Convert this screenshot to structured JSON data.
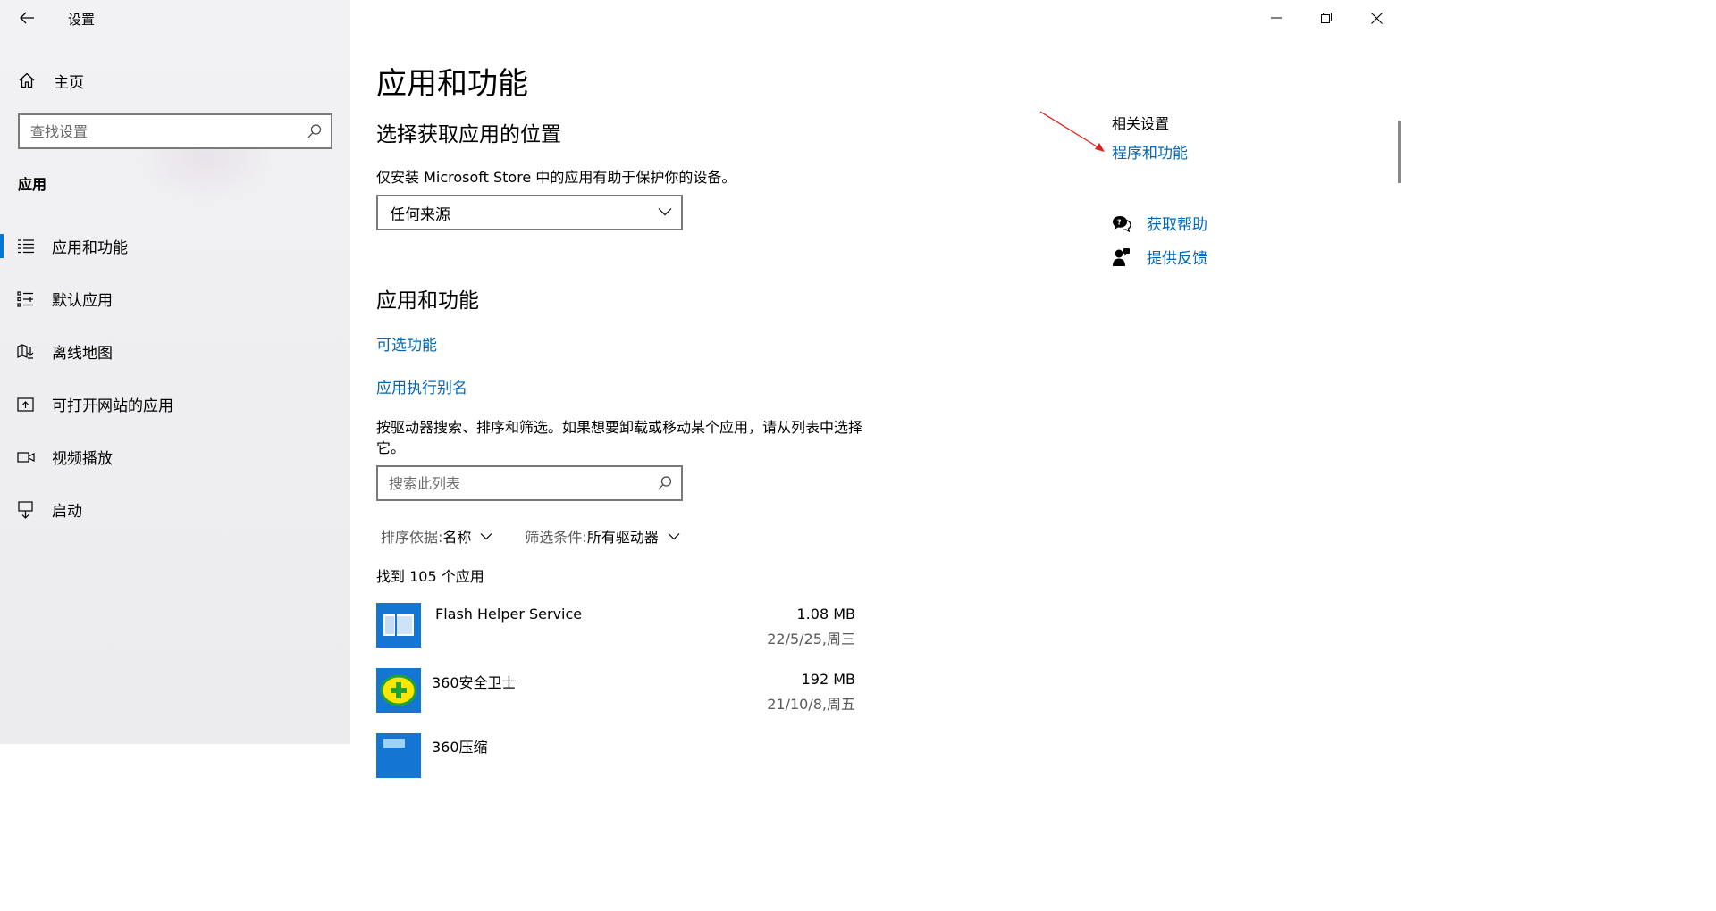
{
  "window": {
    "title": "设置"
  },
  "sidebar": {
    "home_label": "主页",
    "search_placeholder": "查找设置",
    "section_label": "应用",
    "items": [
      {
        "label": "应用和功能",
        "icon": "apps-list-icon",
        "active": true
      },
      {
        "label": "默认应用",
        "icon": "default-apps-icon",
        "active": false
      },
      {
        "label": "离线地图",
        "icon": "map-download-icon",
        "active": false
      },
      {
        "label": "可打开网站的应用",
        "icon": "open-web-icon",
        "active": false
      },
      {
        "label": "视频播放",
        "icon": "video-icon",
        "active": false
      },
      {
        "label": "启动",
        "icon": "startup-icon",
        "active": false
      }
    ]
  },
  "main": {
    "page_title": "应用和功能",
    "source_heading": "选择获取应用的位置",
    "source_desc": "仅安装 Microsoft Store 中的应用有助于保护你的设备。",
    "source_value": "任何来源",
    "apps_heading": "应用和功能",
    "optional_features_link": "可选功能",
    "alias_link": "应用执行别名",
    "list_desc": "按驱动器搜索、排序和筛选。如果想要卸载或移动某个应用，请从列表中选择它。",
    "list_search_placeholder": "搜索此列表",
    "sort_key": "排序依据: ",
    "sort_value": "名称",
    "filter_key": "筛选条件: ",
    "filter_value": "所有驱动器",
    "found_count": "找到 105 个应用",
    "apps": [
      {
        "name": "Flash Helper Service",
        "size": "1.08 MB",
        "date": "22/5/25,周三",
        "icon": "flash-helper-icon"
      },
      {
        "name": "360安全卫士",
        "size": "192 MB",
        "date": "21/10/8,周五",
        "icon": "360-security-icon"
      },
      {
        "name": "360压缩",
        "size": "",
        "date": "",
        "icon": "360-zip-icon"
      }
    ]
  },
  "related": {
    "title": "相关设置",
    "programs_link": "程序和功能",
    "help_label": "获取帮助",
    "feedback_label": "提供反馈"
  },
  "colors": {
    "accent": "#0067b8",
    "active_bar": "#0078d7",
    "annotation_arrow": "#e02020"
  }
}
